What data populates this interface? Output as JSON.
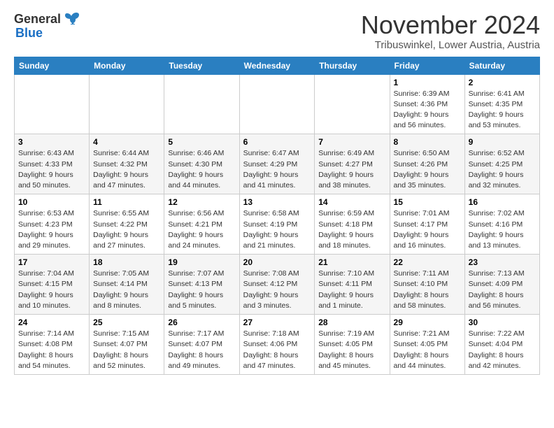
{
  "header": {
    "logo_general": "General",
    "logo_blue": "Blue",
    "month": "November 2024",
    "location": "Tribuswinkel, Lower Austria, Austria"
  },
  "days_of_week": [
    "Sunday",
    "Monday",
    "Tuesday",
    "Wednesday",
    "Thursday",
    "Friday",
    "Saturday"
  ],
  "weeks": [
    [
      {
        "day": "",
        "info": ""
      },
      {
        "day": "",
        "info": ""
      },
      {
        "day": "",
        "info": ""
      },
      {
        "day": "",
        "info": ""
      },
      {
        "day": "",
        "info": ""
      },
      {
        "day": "1",
        "info": "Sunrise: 6:39 AM\nSunset: 4:36 PM\nDaylight: 9 hours and 56 minutes."
      },
      {
        "day": "2",
        "info": "Sunrise: 6:41 AM\nSunset: 4:35 PM\nDaylight: 9 hours and 53 minutes."
      }
    ],
    [
      {
        "day": "3",
        "info": "Sunrise: 6:43 AM\nSunset: 4:33 PM\nDaylight: 9 hours and 50 minutes."
      },
      {
        "day": "4",
        "info": "Sunrise: 6:44 AM\nSunset: 4:32 PM\nDaylight: 9 hours and 47 minutes."
      },
      {
        "day": "5",
        "info": "Sunrise: 6:46 AM\nSunset: 4:30 PM\nDaylight: 9 hours and 44 minutes."
      },
      {
        "day": "6",
        "info": "Sunrise: 6:47 AM\nSunset: 4:29 PM\nDaylight: 9 hours and 41 minutes."
      },
      {
        "day": "7",
        "info": "Sunrise: 6:49 AM\nSunset: 4:27 PM\nDaylight: 9 hours and 38 minutes."
      },
      {
        "day": "8",
        "info": "Sunrise: 6:50 AM\nSunset: 4:26 PM\nDaylight: 9 hours and 35 minutes."
      },
      {
        "day": "9",
        "info": "Sunrise: 6:52 AM\nSunset: 4:25 PM\nDaylight: 9 hours and 32 minutes."
      }
    ],
    [
      {
        "day": "10",
        "info": "Sunrise: 6:53 AM\nSunset: 4:23 PM\nDaylight: 9 hours and 29 minutes."
      },
      {
        "day": "11",
        "info": "Sunrise: 6:55 AM\nSunset: 4:22 PM\nDaylight: 9 hours and 27 minutes."
      },
      {
        "day": "12",
        "info": "Sunrise: 6:56 AM\nSunset: 4:21 PM\nDaylight: 9 hours and 24 minutes."
      },
      {
        "day": "13",
        "info": "Sunrise: 6:58 AM\nSunset: 4:19 PM\nDaylight: 9 hours and 21 minutes."
      },
      {
        "day": "14",
        "info": "Sunrise: 6:59 AM\nSunset: 4:18 PM\nDaylight: 9 hours and 18 minutes."
      },
      {
        "day": "15",
        "info": "Sunrise: 7:01 AM\nSunset: 4:17 PM\nDaylight: 9 hours and 16 minutes."
      },
      {
        "day": "16",
        "info": "Sunrise: 7:02 AM\nSunset: 4:16 PM\nDaylight: 9 hours and 13 minutes."
      }
    ],
    [
      {
        "day": "17",
        "info": "Sunrise: 7:04 AM\nSunset: 4:15 PM\nDaylight: 9 hours and 10 minutes."
      },
      {
        "day": "18",
        "info": "Sunrise: 7:05 AM\nSunset: 4:14 PM\nDaylight: 9 hours and 8 minutes."
      },
      {
        "day": "19",
        "info": "Sunrise: 7:07 AM\nSunset: 4:13 PM\nDaylight: 9 hours and 5 minutes."
      },
      {
        "day": "20",
        "info": "Sunrise: 7:08 AM\nSunset: 4:12 PM\nDaylight: 9 hours and 3 minutes."
      },
      {
        "day": "21",
        "info": "Sunrise: 7:10 AM\nSunset: 4:11 PM\nDaylight: 9 hours and 1 minute."
      },
      {
        "day": "22",
        "info": "Sunrise: 7:11 AM\nSunset: 4:10 PM\nDaylight: 8 hours and 58 minutes."
      },
      {
        "day": "23",
        "info": "Sunrise: 7:13 AM\nSunset: 4:09 PM\nDaylight: 8 hours and 56 minutes."
      }
    ],
    [
      {
        "day": "24",
        "info": "Sunrise: 7:14 AM\nSunset: 4:08 PM\nDaylight: 8 hours and 54 minutes."
      },
      {
        "day": "25",
        "info": "Sunrise: 7:15 AM\nSunset: 4:07 PM\nDaylight: 8 hours and 52 minutes."
      },
      {
        "day": "26",
        "info": "Sunrise: 7:17 AM\nSunset: 4:07 PM\nDaylight: 8 hours and 49 minutes."
      },
      {
        "day": "27",
        "info": "Sunrise: 7:18 AM\nSunset: 4:06 PM\nDaylight: 8 hours and 47 minutes."
      },
      {
        "day": "28",
        "info": "Sunrise: 7:19 AM\nSunset: 4:05 PM\nDaylight: 8 hours and 45 minutes."
      },
      {
        "day": "29",
        "info": "Sunrise: 7:21 AM\nSunset: 4:05 PM\nDaylight: 8 hours and 44 minutes."
      },
      {
        "day": "30",
        "info": "Sunrise: 7:22 AM\nSunset: 4:04 PM\nDaylight: 8 hours and 42 minutes."
      }
    ]
  ]
}
